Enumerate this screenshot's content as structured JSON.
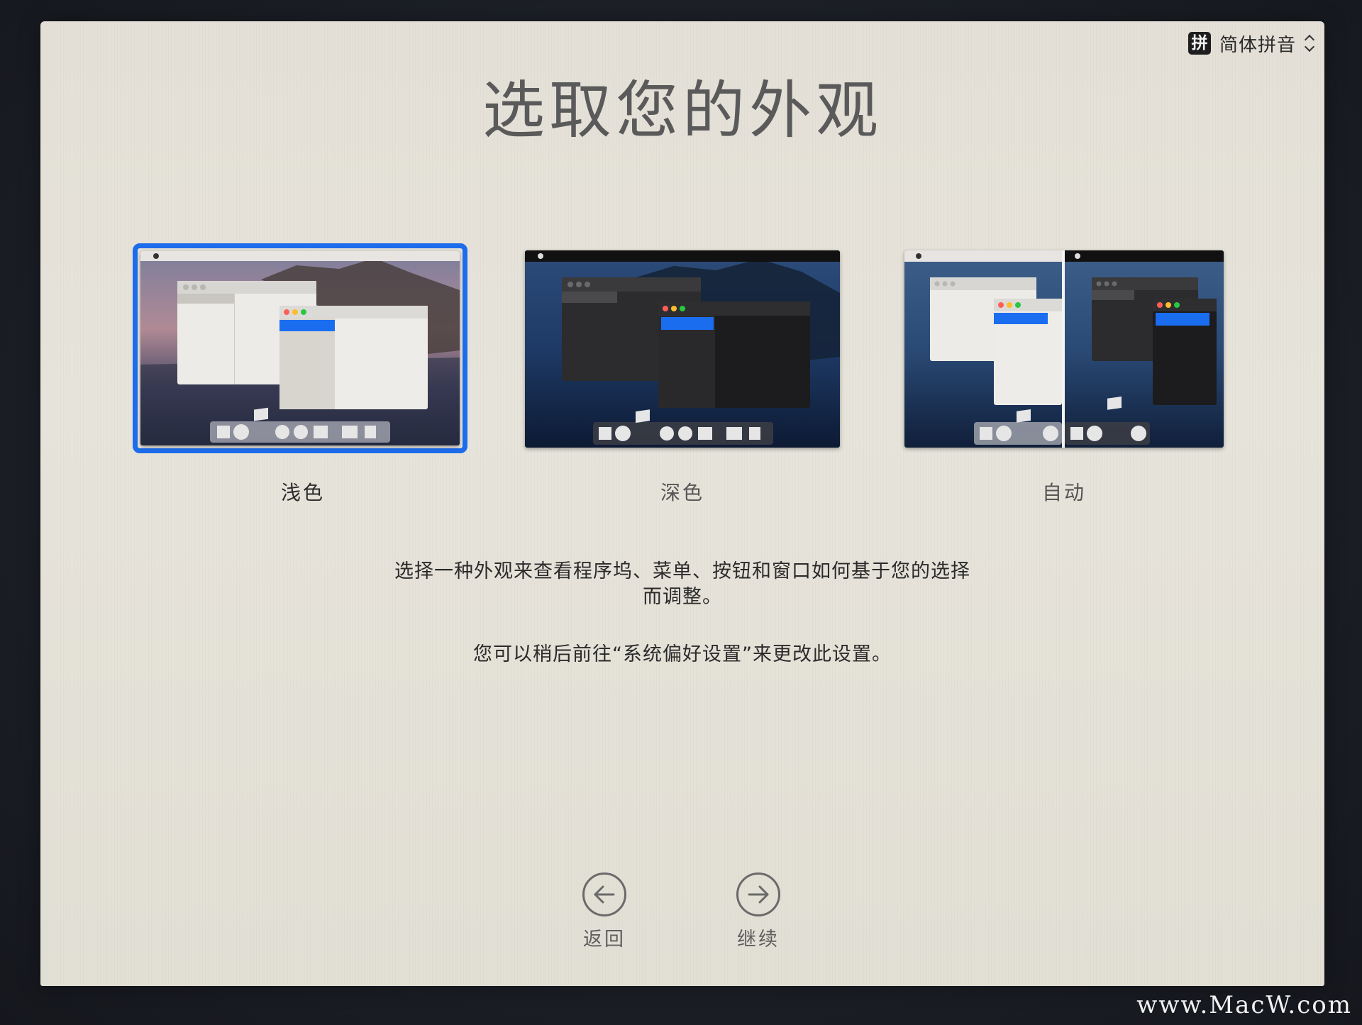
{
  "input_method": {
    "icon_glyph": "拼",
    "label": "简体拼音"
  },
  "page_title": "选取您的外观",
  "options": [
    {
      "label": "浅色",
      "selected": true
    },
    {
      "label": "深色",
      "selected": false
    },
    {
      "label": "自动",
      "selected": false
    }
  ],
  "description": {
    "line1": "选择一种外观来查看程序坞、菜单、按钮和窗口如何基于您的选择",
    "line2": "而调整。",
    "line3": "您可以稍后前往“系统偏好设置”来更改此设置。"
  },
  "nav": {
    "back_label": "返回",
    "continue_label": "继续"
  },
  "watermark": "www.MacW.com",
  "colors": {
    "accent": "#1c6cec",
    "screen_bg": "#e6e3da",
    "title": "#5a5a5a"
  }
}
